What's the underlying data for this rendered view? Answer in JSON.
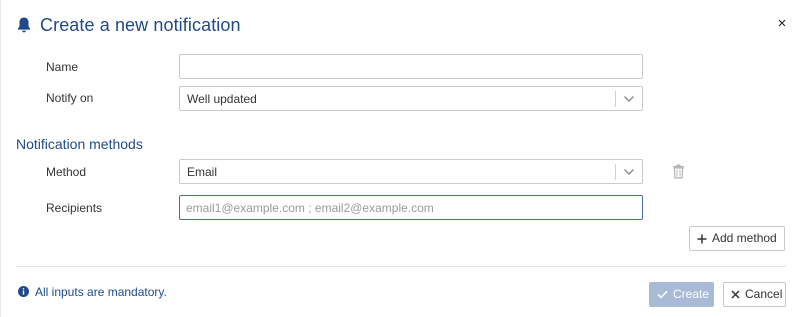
{
  "dialog": {
    "title": "Create a new notification",
    "close_glyph": "×",
    "header_icon": "bell-icon"
  },
  "form": {
    "name": {
      "label": "Name",
      "value": "",
      "placeholder": ""
    },
    "notify_on": {
      "label": "Notify on",
      "selected": "Well updated"
    }
  },
  "methods_section": {
    "title": "Notification methods",
    "method": {
      "label": "Method",
      "selected": "Email"
    },
    "recipients": {
      "label": "Recipients",
      "value": "",
      "placeholder": "email1@example.com ; email2@example.com"
    },
    "add_method_label": "Add method"
  },
  "footer": {
    "info_text": "All inputs are mandatory.",
    "create_label": "Create",
    "cancel_label": "Cancel"
  },
  "colors": {
    "title": "#1f4a8a",
    "create_disabled_bg": "#a8bad6",
    "focus_border": "#4a6fa5"
  }
}
